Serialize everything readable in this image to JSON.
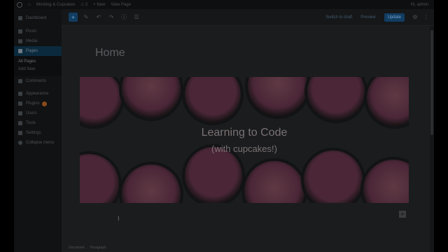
{
  "admin_bar": {
    "site_name": "Working & Cupcakes",
    "comments_count": "2",
    "new_label": "+ New",
    "view_page_label": "View Page",
    "greeting": "Hi, admin"
  },
  "sidebar": {
    "items": [
      {
        "label": "Dashboard",
        "icon": "gauge-icon"
      },
      {
        "label": "Posts",
        "icon": "pin-icon"
      },
      {
        "label": "Media",
        "icon": "media-icon"
      },
      {
        "label": "Pages",
        "icon": "pages-icon"
      },
      {
        "label": "Comments",
        "icon": "comment-icon"
      },
      {
        "label": "Appearance",
        "icon": "brush-icon"
      },
      {
        "label": "Plugins",
        "icon": "plug-icon"
      },
      {
        "label": "Users",
        "icon": "user-icon"
      },
      {
        "label": "Tools",
        "icon": "wrench-icon"
      },
      {
        "label": "Settings",
        "icon": "settings-icon"
      },
      {
        "label": "Collapse menu",
        "icon": "collapse-icon"
      }
    ],
    "submenu": [
      "All Pages",
      "Add New"
    ]
  },
  "toolbar": {
    "add_block": "+",
    "switch_draft": "Switch to draft",
    "preview": "Preview",
    "update": "Update"
  },
  "editor": {
    "title": "Home",
    "cover_title": "Learning to Code",
    "cover_subtitle": "(with cupcakes!)",
    "add_block_inline": "+",
    "breadcrumb": "Document → Paragraph"
  },
  "colors": {
    "accent": "#123d63",
    "frosting": "#4a2637",
    "frosting_light": "#5f3a44"
  }
}
